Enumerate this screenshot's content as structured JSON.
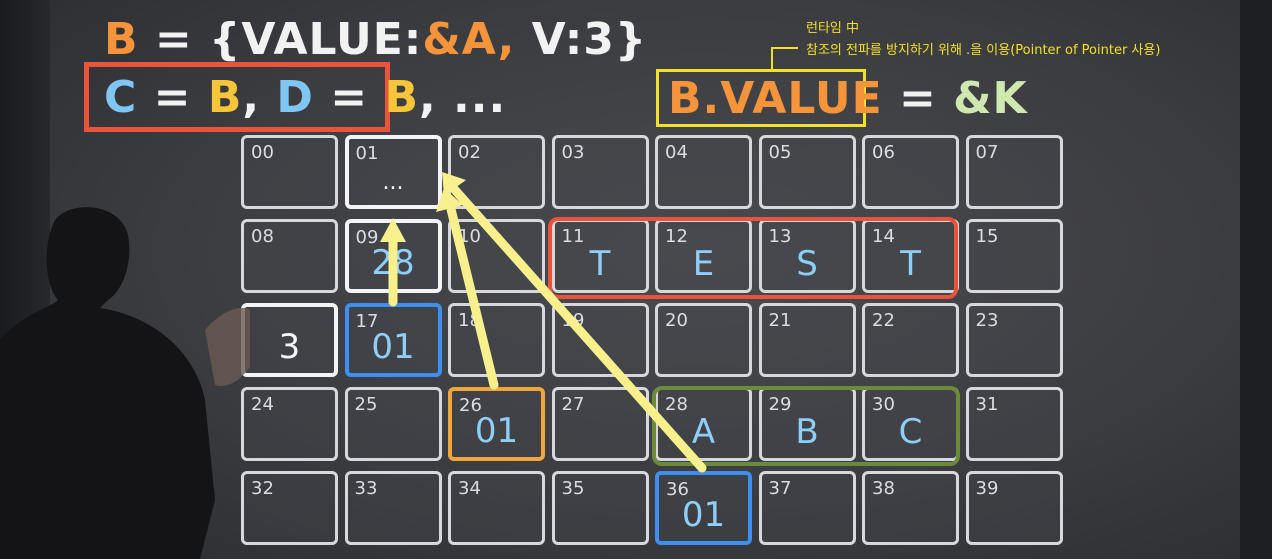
{
  "line1": {
    "b": "B",
    "eq": " = {VALUE:",
    "amp_a": "&A,",
    "rest": " V:3}"
  },
  "line2": {
    "c": "C",
    "eq1": " = ",
    "b1": "B",
    "comma": ", ",
    "d": "D",
    "eq2": " = ",
    "b2": "B",
    "tail": ", ..."
  },
  "right": {
    "lhs": "B.VALUE",
    "eq": " = ",
    "rhs": "&K"
  },
  "annotation": {
    "line1": "런타임 中",
    "line2": "참조의 전파를 방지하기 위해 .을 이용(Pointer of Pointer 사용)"
  },
  "grid": {
    "rows": [
      [
        {
          "i": "00",
          "v": ""
        },
        {
          "i": "01",
          "v": "..."
        },
        {
          "i": "02",
          "v": ""
        },
        {
          "i": "03",
          "v": ""
        },
        {
          "i": "04",
          "v": ""
        },
        {
          "i": "05",
          "v": ""
        },
        {
          "i": "06",
          "v": ""
        },
        {
          "i": "07",
          "v": ""
        }
      ],
      [
        {
          "i": "08",
          "v": ""
        },
        {
          "i": "09",
          "v": "28"
        },
        {
          "i": "10",
          "v": ""
        },
        {
          "i": "11",
          "v": "T"
        },
        {
          "i": "12",
          "v": "E"
        },
        {
          "i": "13",
          "v": "S"
        },
        {
          "i": "14",
          "v": "T"
        },
        {
          "i": "15",
          "v": ""
        }
      ],
      [
        {
          "i": "",
          "v": "3"
        },
        {
          "i": "17",
          "v": "01"
        },
        {
          "i": "18",
          "v": ""
        },
        {
          "i": "19",
          "v": ""
        },
        {
          "i": "20",
          "v": ""
        },
        {
          "i": "21",
          "v": ""
        },
        {
          "i": "22",
          "v": ""
        },
        {
          "i": "23",
          "v": ""
        }
      ],
      [
        {
          "i": "24",
          "v": ""
        },
        {
          "i": "25",
          "v": ""
        },
        {
          "i": "26",
          "v": "01"
        },
        {
          "i": "27",
          "v": ""
        },
        {
          "i": "28",
          "v": "A"
        },
        {
          "i": "29",
          "v": "B"
        },
        {
          "i": "30",
          "v": "C"
        },
        {
          "i": "31",
          "v": ""
        }
      ],
      [
        {
          "i": "32",
          "v": ""
        },
        {
          "i": "33",
          "v": ""
        },
        {
          "i": "34",
          "v": ""
        },
        {
          "i": "35",
          "v": ""
        },
        {
          "i": "36",
          "v": "01"
        },
        {
          "i": "37",
          "v": ""
        },
        {
          "i": "38",
          "v": ""
        },
        {
          "i": "39",
          "v": ""
        }
      ]
    ]
  },
  "colors": {
    "orange": "#f5943a",
    "yellow": "#f7c53a",
    "blue": "#7fc7f2",
    "red": "#e8553c",
    "annotation": "#f2e02a",
    "arrow": "#f7f08c"
  }
}
